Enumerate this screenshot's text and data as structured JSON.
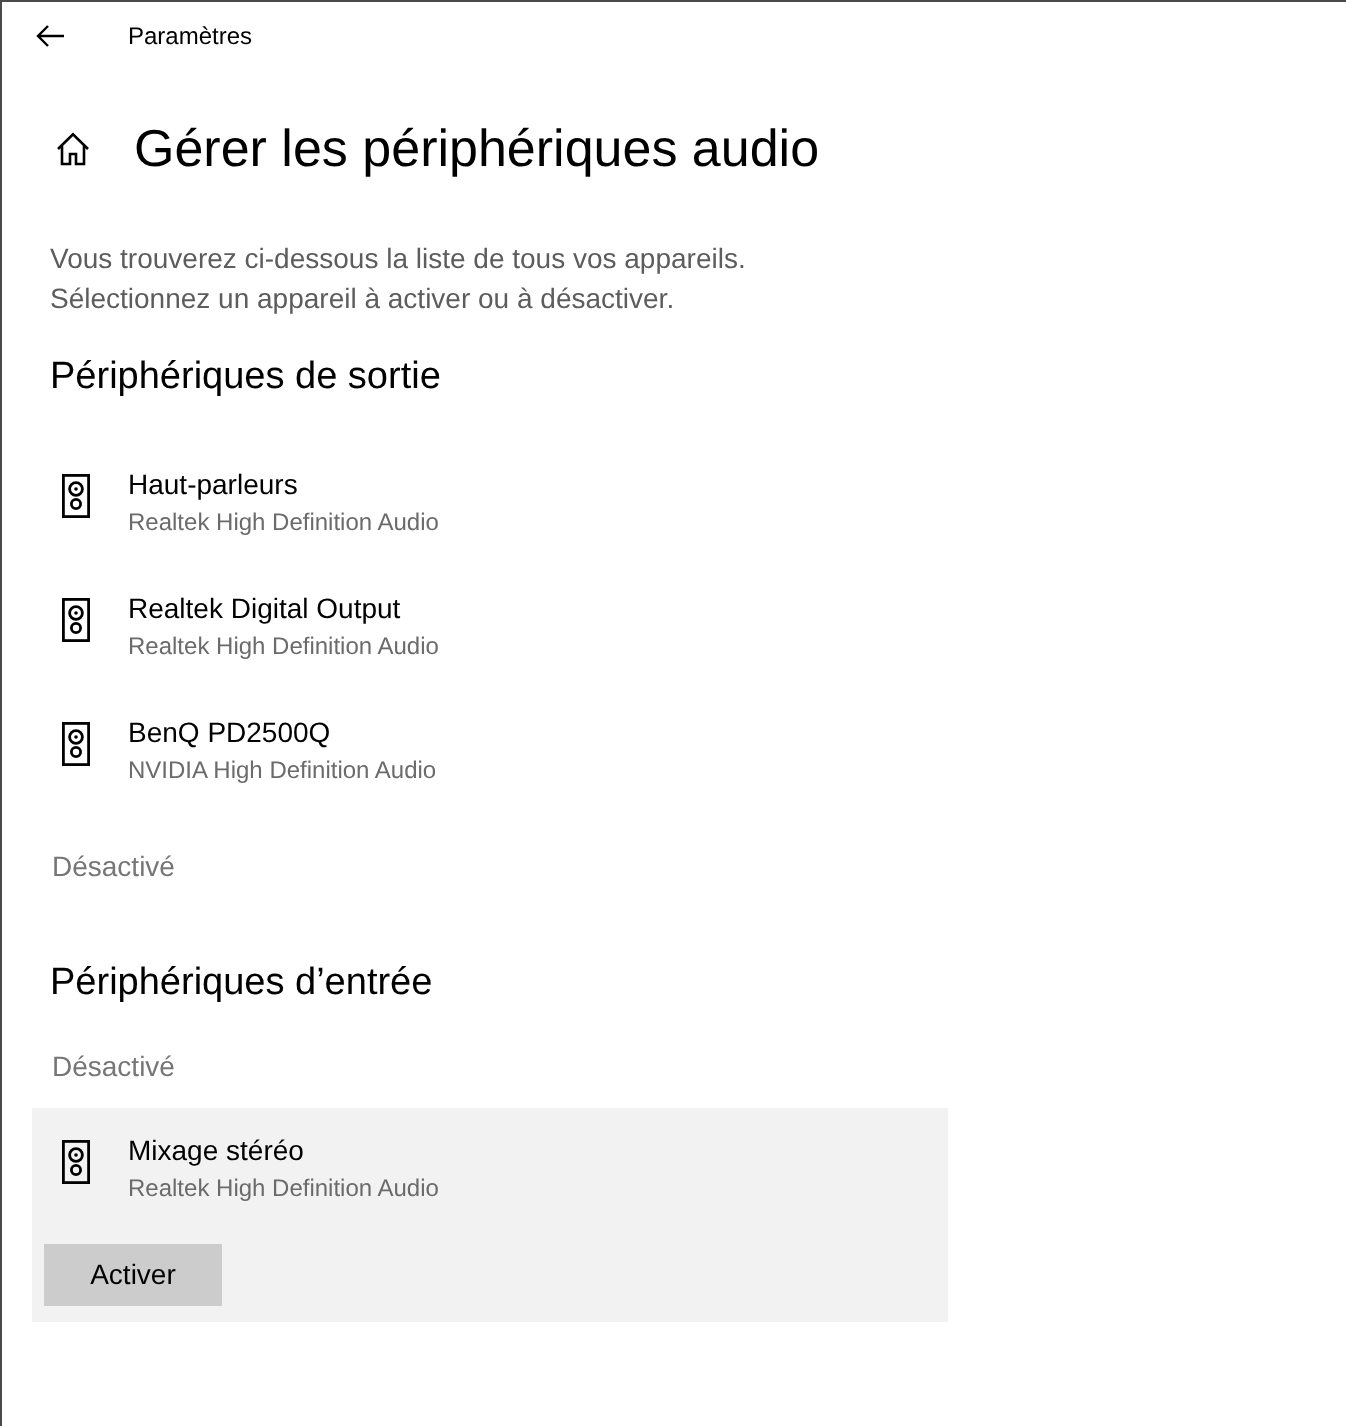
{
  "window": {
    "title": "Paramètres"
  },
  "page": {
    "title": "Gérer les périphériques audio",
    "description": [
      "Vous trouverez ci-dessous la liste de tous vos appareils.",
      "Sélectionnez un appareil à activer ou à désactiver."
    ]
  },
  "sections": [
    {
      "heading": "Périphériques de sortie",
      "items": [
        {
          "kind": "device",
          "name": "Haut-parleurs",
          "driver": "Realtek High Definition Audio",
          "selected": false
        },
        {
          "kind": "device",
          "name": "Realtek Digital Output",
          "driver": "Realtek High Definition Audio",
          "selected": false
        },
        {
          "kind": "device",
          "name": "BenQ PD2500Q",
          "driver": "NVIDIA High Definition Audio",
          "selected": false
        },
        {
          "kind": "status",
          "label": "Désactivé"
        }
      ]
    },
    {
      "heading": "Périphériques d’entrée",
      "items": [
        {
          "kind": "status",
          "label": "Désactivé"
        },
        {
          "kind": "device",
          "name": "Mixage stéréo",
          "driver": "Realtek High Definition Audio",
          "selected": true,
          "button": "Activer"
        }
      ]
    }
  ]
}
